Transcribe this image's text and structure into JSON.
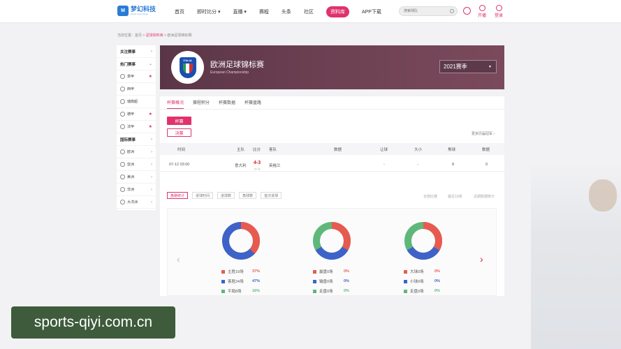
{
  "nav": {
    "logo_badge": "M",
    "logo_cn": "梦幻科技",
    "logo_en": "Dream Technology",
    "links": [
      "首页",
      "即时比分 ▾",
      "直播 ▾",
      "赛程",
      "头条",
      "社区",
      "资料库",
      "APP下载"
    ],
    "active_link": "资料库",
    "search_placeholder": "搜索球队",
    "open_label": "开播",
    "login_label": "登录"
  },
  "breadcrumb": {
    "prefix": "当前位置：",
    "home": "首页",
    "sep1": " > ",
    "library": "足球资料库",
    "sep2": " > ",
    "current": "欧洲足球锦标赛"
  },
  "sidebar": {
    "items": [
      {
        "label": "关注赛事",
        "kind": "head"
      },
      {
        "label": "热门赛事",
        "kind": "head-down"
      },
      {
        "label": "意甲",
        "kind": "sub-star"
      },
      {
        "label": "西甲",
        "kind": "sub"
      },
      {
        "label": "瑞典超",
        "kind": "sub"
      },
      {
        "label": "德甲",
        "kind": "sub-star"
      },
      {
        "label": "法甲",
        "kind": "sub-star"
      },
      {
        "label": "国际赛事",
        "kind": "head"
      },
      {
        "label": "欧洲",
        "kind": "region"
      },
      {
        "label": "亚洲",
        "kind": "region"
      },
      {
        "label": "美洲",
        "kind": "region"
      },
      {
        "label": "非洲",
        "kind": "region"
      },
      {
        "label": "大洋洲",
        "kind": "region"
      }
    ]
  },
  "banner": {
    "crest_text": "ITALIA",
    "title": "欧洲足球锦标赛",
    "subtitle": "European Championship",
    "season": "2021赛季"
  },
  "tabs": [
    "杯赛概况",
    "赛程积分",
    "杯赛数据",
    "杯赛盘路"
  ],
  "stage_buttons": {
    "active": "杯赛",
    "inactive": "决赛"
  },
  "right_link": "更多历届冠军 ›",
  "table": {
    "headers": [
      "时间",
      "主队",
      "比分",
      "客队",
      "数据",
      "让球",
      "大小",
      "角球",
      "数据"
    ],
    "row": {
      "time": "07-12 03:00",
      "home": "意大利",
      "score": "4-3",
      "score_sub": "(1-1)",
      "away": "英格兰",
      "data": "",
      "handicap": "-",
      "ou": "-",
      "corners": "8",
      "data2": "0"
    }
  },
  "filters": {
    "chips": [
      "盘路统计",
      "进球时间",
      "进球数",
      "角球数",
      "首次进球"
    ],
    "active": "盘路统计",
    "right": [
      "全部比赛",
      "最近10场",
      "近期数据统计"
    ]
  },
  "charts": [
    {
      "legend": [
        {
          "label": "主胜19场",
          "pct": "37%",
          "color": "#e85a4f"
        },
        {
          "label": "客胜24场",
          "pct": "47%",
          "color": "#3f62c8"
        },
        {
          "label": "平局8场",
          "pct": "16%",
          "color": "#5fb87a"
        }
      ]
    },
    {
      "legend": [
        {
          "label": "赢盘0场",
          "pct": "0%",
          "color": "#e85a4f"
        },
        {
          "label": "输盘0场",
          "pct": "0%",
          "color": "#3f62c8"
        },
        {
          "label": "走盘0场",
          "pct": "0%",
          "color": "#5fb87a"
        }
      ]
    },
    {
      "legend": [
        {
          "label": "大球0场",
          "pct": "0%",
          "color": "#e85a4f"
        },
        {
          "label": "小球0场",
          "pct": "0%",
          "color": "#3f62c8"
        },
        {
          "label": "走盘0场",
          "pct": "0%",
          "color": "#5fb87a"
        }
      ]
    }
  ],
  "watermark": "sports-qiyi.com.cn",
  "colors": {
    "accent": "#e0326e",
    "banner": "#6d4152",
    "red": "#e85a4f",
    "blue": "#3f62c8",
    "green": "#5fb87a"
  }
}
